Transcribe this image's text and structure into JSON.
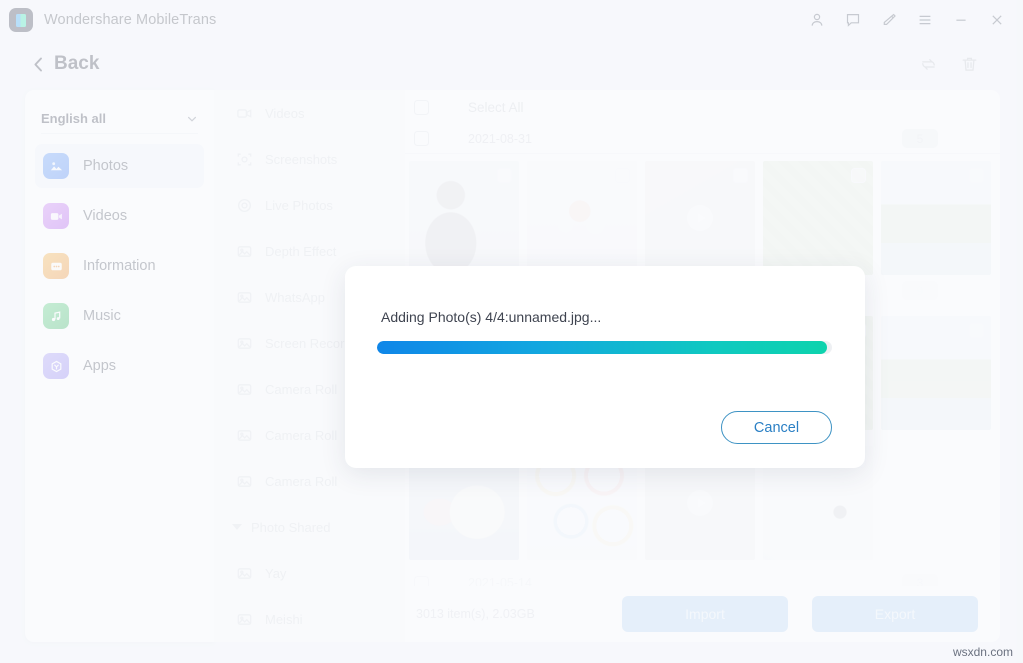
{
  "window": {
    "app_title": "Wondershare MobileTrans",
    "logo_icon": "mobiletrans-logo-icon",
    "controls": [
      {
        "name": "account-icon",
        "glyph": "account"
      },
      {
        "name": "feedback-icon",
        "glyph": "comment"
      },
      {
        "name": "edit-icon",
        "glyph": "pen"
      },
      {
        "name": "menu-icon",
        "glyph": "hamburger"
      },
      {
        "name": "minimize-icon",
        "glyph": "minimize"
      },
      {
        "name": "close-icon",
        "glyph": "close"
      }
    ]
  },
  "header": {
    "back_label": "Back",
    "back_icon": "chevron-left-icon",
    "tools": [
      {
        "name": "refresh-icon",
        "glyph": "refresh"
      },
      {
        "name": "delete-icon",
        "glyph": "trash"
      }
    ]
  },
  "sidebar": {
    "language_selector": {
      "label": "English all",
      "icon": "chevron-down-icon"
    },
    "items": [
      {
        "label": "Photos",
        "icon": "photos-icon",
        "icon_class": "ic-photos",
        "active": true
      },
      {
        "label": "Videos",
        "icon": "videos-icon",
        "icon_class": "ic-videos",
        "active": false
      },
      {
        "label": "Information",
        "icon": "information-icon",
        "icon_class": "ic-info",
        "active": false
      },
      {
        "label": "Music",
        "icon": "music-icon",
        "icon_class": "ic-music",
        "active": false
      },
      {
        "label": "Apps",
        "icon": "apps-icon",
        "icon_class": "ic-apps",
        "active": false
      }
    ]
  },
  "categories": [
    {
      "label": "Videos",
      "icon": "video-camera-icon",
      "type": "item"
    },
    {
      "label": "Screenshots",
      "icon": "screenshot-icon",
      "type": "item"
    },
    {
      "label": "Live Photos",
      "icon": "live-photo-icon",
      "type": "item"
    },
    {
      "label": "Depth Effect",
      "icon": "image-icon",
      "type": "item"
    },
    {
      "label": "WhatsApp",
      "icon": "image-icon",
      "type": "item"
    },
    {
      "label": "Screen Recorder",
      "icon": "image-icon",
      "type": "item"
    },
    {
      "label": "Camera Roll",
      "icon": "image-icon",
      "type": "item"
    },
    {
      "label": "Camera Roll",
      "icon": "image-icon",
      "type": "item"
    },
    {
      "label": "Camera Roll",
      "icon": "image-icon",
      "type": "item"
    },
    {
      "label": "Photo Shared",
      "icon": "triangle-down-icon",
      "type": "group"
    },
    {
      "label": "Yay",
      "icon": "image-icon",
      "type": "item"
    },
    {
      "label": "Meishi",
      "icon": "image-icon",
      "type": "item"
    }
  ],
  "main": {
    "select_all_label": "Select All",
    "groups": [
      {
        "date": "2021-08-31",
        "count": "5"
      },
      {
        "date": "",
        "count": "9"
      },
      {
        "date": "2021-05-14",
        "count": "3"
      }
    ],
    "row1_thumbs": [
      {
        "name": "thumb-person",
        "class": "t-person",
        "kind": "photo"
      },
      {
        "name": "thumb-flowers",
        "class": "t-flowers",
        "kind": "photo"
      },
      {
        "name": "thumb-video-1",
        "class": "t-video1",
        "kind": "video"
      },
      {
        "name": "thumb-moss",
        "class": "t-moss",
        "kind": "photo"
      },
      {
        "name": "thumb-palm",
        "class": "t-palm",
        "kind": "photo"
      }
    ],
    "row2_thumbs": [
      {
        "name": "thumb-moss-2",
        "class": "t-moss",
        "kind": "photo"
      },
      {
        "name": "thumb-palm-2",
        "class": "t-palm",
        "kind": "photo"
      }
    ],
    "row3_thumbs": [
      {
        "name": "thumb-artwork",
        "class": "t-art",
        "kind": "photo"
      },
      {
        "name": "thumb-chart",
        "class": "t-chart",
        "kind": "photo"
      },
      {
        "name": "thumb-video-2",
        "class": "t-video2",
        "kind": "video"
      },
      {
        "name": "thumb-cables",
        "class": "t-cables",
        "kind": "photo"
      }
    ]
  },
  "footer": {
    "items_info": "3013 item(s), 2.03GB",
    "import_label": "Import",
    "export_label": "Export"
  },
  "modal": {
    "message": "Adding Photo(s) 4/4:unnamed.jpg...",
    "progress_percent": 99,
    "cancel_label": "Cancel",
    "progress_start_color": "#0f86e8",
    "progress_end_color": "#0ed3ad"
  },
  "watermark": "wsxdn.com"
}
